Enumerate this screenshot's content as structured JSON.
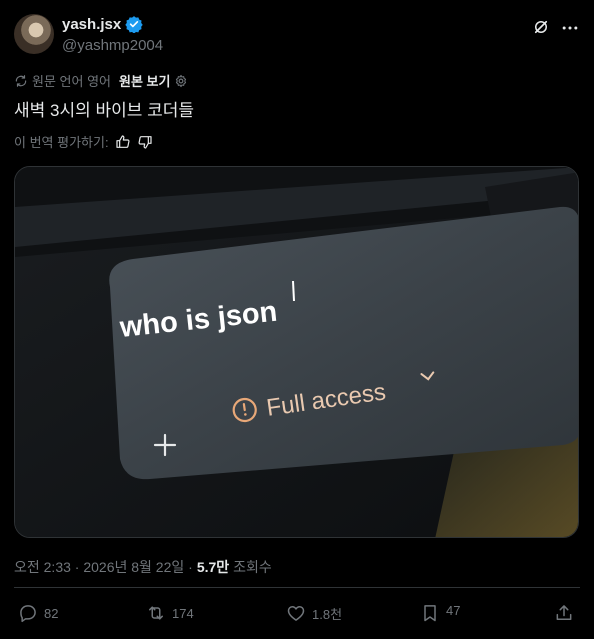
{
  "author": {
    "display_name": "yash.jsx",
    "handle": "@yashmp2004"
  },
  "translation": {
    "original_language_label": "원문 언어 영어",
    "show_original_label": "원본 보기"
  },
  "tweet": {
    "text": "새벽 3시의 바이브 코더들",
    "rate_translation_label": "이 번역 평가하기:"
  },
  "media": {
    "input_text": "who is json",
    "access_label": "Full access"
  },
  "meta": {
    "timestamp": "오전 2:33 · 2026년 8월 22일 ·",
    "views_count": "5.7만",
    "views_label": "조회수"
  },
  "actions": {
    "replies": "82",
    "reposts": "174",
    "likes": "1.8천",
    "bookmarks": "47"
  },
  "colors": {
    "background": "#000000",
    "text_primary": "#e7e9ea",
    "text_secondary": "#71767b",
    "verified": "#1d9bf0",
    "border": "#2f3336"
  }
}
